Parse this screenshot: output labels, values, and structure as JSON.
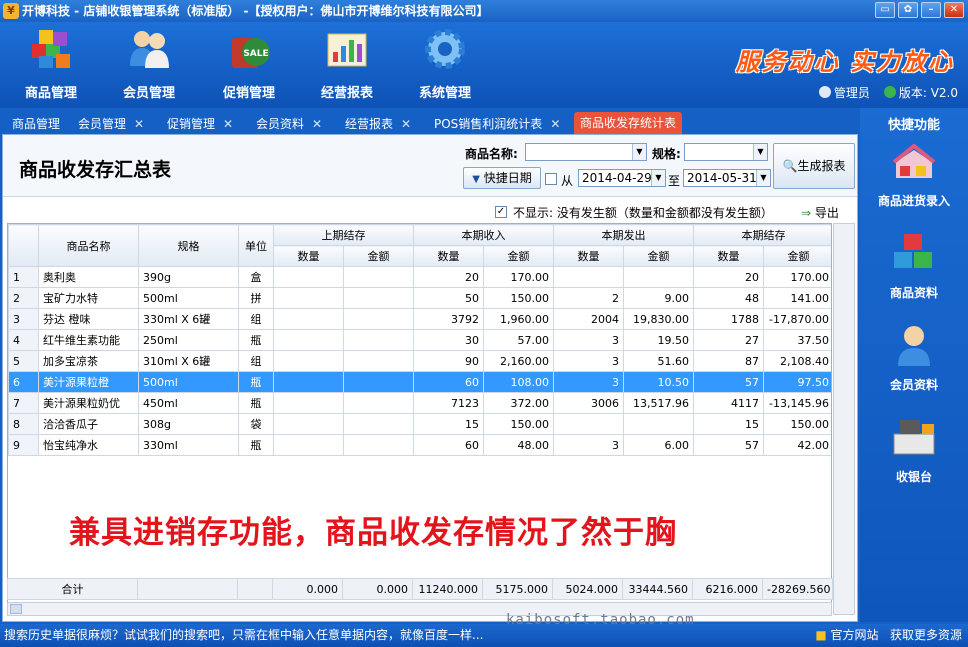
{
  "window": {
    "title": "开博科技 - 店铺收银管理系统（标准版）  -【授权用户：佛山市开博维尔科技有限公司】",
    "app_icon": "¥"
  },
  "toolbar": {
    "items": [
      {
        "label": "商品管理",
        "icon": "blocks-icon"
      },
      {
        "label": "会员管理",
        "icon": "members-icon"
      },
      {
        "label": "促销管理",
        "icon": "sale-bag-icon"
      },
      {
        "label": "经营报表",
        "icon": "chart-report-icon"
      },
      {
        "label": "系统管理",
        "icon": "gear-icon"
      }
    ],
    "slogan": "服务动心 实力放心",
    "user_label": "管理员",
    "version_label": "版本: V2.0"
  },
  "tabs": [
    {
      "label": "商品管理",
      "closable": false
    },
    {
      "label": "会员管理",
      "closable": true
    },
    {
      "label": "促销管理",
      "closable": true
    },
    {
      "label": "会员资料",
      "closable": true
    },
    {
      "label": "经营报表",
      "closable": true
    },
    {
      "label": "POS销售利润统计表",
      "closable": true
    },
    {
      "label": "商品收发存统计表",
      "closable": false,
      "active": true
    }
  ],
  "report": {
    "title": "商品收发存汇总表",
    "name_label": "商品名称:",
    "name_value": "",
    "spec_label": "规格:",
    "spec_value": "",
    "quick_date_label": "快捷日期",
    "from_label": "从",
    "from_date": "2014-04-29",
    "to_label": "至",
    "to_date": "2014-05-31",
    "generate_label": "生成报表",
    "hide_label": "不显示: 没有发生额（数量和金额都没有发生额）",
    "hide_checked": true,
    "export_label": "导出"
  },
  "table": {
    "header_groups": [
      "上期结存",
      "本期收入",
      "本期发出",
      "本期结存"
    ],
    "headers": [
      "商品名称",
      "规格",
      "单位"
    ],
    "sub_headers": [
      "数量",
      "金额"
    ],
    "rows": [
      {
        "no": "1",
        "name": "奥利奥",
        "spec": "390g",
        "unit": "盒",
        "c1": "",
        "c2": "",
        "c3": "20",
        "c4": "170.00",
        "c5": "",
        "c6": "",
        "c7": "20",
        "c8": "170.00"
      },
      {
        "no": "2",
        "name": "宝矿力水特",
        "spec": "500ml",
        "unit": "拼",
        "c1": "",
        "c2": "",
        "c3": "50",
        "c4": "150.00",
        "c5": "2",
        "c6": "9.00",
        "c7": "48",
        "c8": "141.00"
      },
      {
        "no": "3",
        "name": "芬达 橙味",
        "spec": "330ml X 6罐",
        "unit": "组",
        "c1": "",
        "c2": "",
        "c3": "3792",
        "c4": "1,960.00",
        "c5": "2004",
        "c6": "19,830.00",
        "c7": "1788",
        "c8": "-17,870.00"
      },
      {
        "no": "4",
        "name": "红牛维生素功能",
        "spec": "250ml",
        "unit": "瓶",
        "c1": "",
        "c2": "",
        "c3": "30",
        "c4": "57.00",
        "c5": "3",
        "c6": "19.50",
        "c7": "27",
        "c8": "37.50"
      },
      {
        "no": "5",
        "name": "加多宝凉茶",
        "spec": "310ml X 6罐",
        "unit": "组",
        "c1": "",
        "c2": "",
        "c3": "90",
        "c4": "2,160.00",
        "c5": "3",
        "c6": "51.60",
        "c7": "87",
        "c8": "2,108.40"
      },
      {
        "no": "6",
        "name": "美汁源果粒橙",
        "spec": "500ml",
        "unit": "瓶",
        "c1": "",
        "c2": "",
        "c3": "60",
        "c4": "108.00",
        "c5": "3",
        "c6": "10.50",
        "c7": "57",
        "c8": "97.50",
        "selected": true
      },
      {
        "no": "7",
        "name": "美汁源果粒奶优",
        "spec": "450ml",
        "unit": "瓶",
        "c1": "",
        "c2": "",
        "c3": "7123",
        "c4": "372.00",
        "c5": "3006",
        "c6": "13,517.96",
        "c7": "4117",
        "c8": "-13,145.96"
      },
      {
        "no": "8",
        "name": "洽洽香瓜子",
        "spec": "308g",
        "unit": "袋",
        "c1": "",
        "c2": "",
        "c3": "15",
        "c4": "150.00",
        "c5": "",
        "c6": "",
        "c7": "15",
        "c8": "150.00"
      },
      {
        "no": "9",
        "name": "怡宝纯净水",
        "spec": "330ml",
        "unit": "瓶",
        "c1": "",
        "c2": "",
        "c3": "60",
        "c4": "48.00",
        "c5": "3",
        "c6": "6.00",
        "c7": "57",
        "c8": "42.00"
      }
    ],
    "total": {
      "label": "合计",
      "c1": "0.000",
      "c2": "0.000",
      "c3": "11240.000",
      "c4": "5175.000",
      "c5": "5024.000",
      "c6": "33444.560",
      "c7": "6216.000",
      "c8": "-28269.560"
    }
  },
  "promo_text": "兼具进销存功能，商品收发存情况了然于胸",
  "quick_panel": {
    "title": "快捷功能",
    "items": [
      {
        "label": "商品进货录入",
        "icon": "goods-purchase-icon"
      },
      {
        "label": "商品资料",
        "icon": "cubes-icon"
      },
      {
        "label": "会员资料",
        "icon": "member-profile-icon"
      },
      {
        "label": "收银台",
        "icon": "cash-register-icon"
      }
    ]
  },
  "status": {
    "tip": "搜索历史单据很麻烦？试试我们的搜索吧，只需在框中输入任意单据内容，就像百度一样...",
    "site_label": "官方网站",
    "more_label": "获取更多资源"
  },
  "watermark": "kaibosoft.taobao.com",
  "colors": {
    "accent_blue": "#1560c4",
    "selected_row": "#3399ff",
    "promo_red": "#e4141c",
    "active_tab": "#e8533a",
    "slogan": "#ff5a14"
  }
}
